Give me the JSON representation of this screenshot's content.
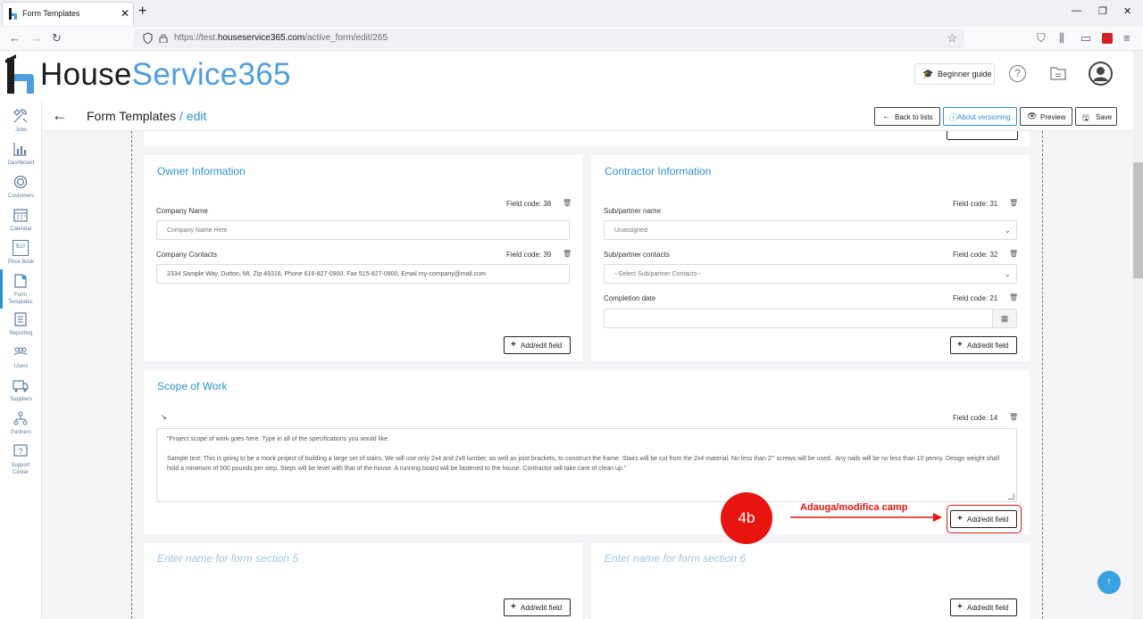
{
  "browser": {
    "tab_title": "Form Templates",
    "url_prefix": "https://test.",
    "url_domain": "houseservice365.com",
    "url_path": "/active_form/edit/265"
  },
  "header": {
    "logo_part1": "House",
    "logo_part2": "Service365",
    "beginner_guide": "Beginner guide"
  },
  "sidebar": {
    "items": [
      {
        "label": "Jobs",
        "icon": "jobs-icon"
      },
      {
        "label": "Dashboard",
        "icon": "dashboard-icon"
      },
      {
        "label": "Customers",
        "icon": "customers-icon"
      },
      {
        "label": "Calendar",
        "icon": "calendar-icon"
      },
      {
        "label": "Price Book",
        "icon": "price-book-icon"
      },
      {
        "label": "Form Templates",
        "icon": "form-templates-icon",
        "active": true
      },
      {
        "label": "Reporting",
        "icon": "reporting-icon"
      },
      {
        "label": "Users",
        "icon": "users-icon"
      },
      {
        "label": "Suppliers",
        "icon": "suppliers-icon"
      },
      {
        "label": "Partners",
        "icon": "partners-icon"
      },
      {
        "label": "Support Center",
        "icon": "support-center-icon"
      }
    ],
    "price_book_tag": "$10"
  },
  "toolbar": {
    "title": "Form Templates",
    "crumb": " / edit",
    "back_to_lists": "Back to lists",
    "about_versioning": "About versioning",
    "preview": "Preview",
    "save": "Save"
  },
  "owner": {
    "title": "Owner Information",
    "field1_code": "Field code: 38",
    "field1_label": "Company Name",
    "field1_placeholder": "Company Name Here",
    "field2_code": "Field code: 39",
    "field2_label": "Company Contacts",
    "field2_value": "2334 Sample Way, Dutton, MI, Zip 49316, Phone 616-827-0900, Fax 515-827-0900, Email my-company@mail.com",
    "add_btn": "Add/edit field"
  },
  "contractor": {
    "title": "Contractor Information",
    "field1_code": "Field code: 31",
    "field1_label": "Sub/partner name",
    "field1_value": "Unassigned",
    "field2_code": "Field code: 32",
    "field2_label": "Sub/partner contacts",
    "field2_value": "--Select Sub/partner Contacts--",
    "field3_code": "Field code: 21",
    "field3_label": "Completion date",
    "add_btn": "Add/edit field"
  },
  "scope": {
    "title": "Scope of Work",
    "field_code": "Field code: 14",
    "line1": "\"Project scope of work goes here. Type in all of the specifications you would like.",
    "line2": "Sample text: This is going to be a mock project of building a large set of stairs. We will use only 2x4 and 2x8 lumber, as well as joist brackets, to construct the frame. Stairs will be cut from the 2x4 material. No less than 2\"' screws will be used.  Any nails will be no less than 10 penny. Design weight shall hold a minimum of 500 pounds per step. Steps will be level with that of the house. A running board will be fastened to the house. Contractor will take care of clean up.\"",
    "add_btn": "Add/edit field"
  },
  "section5": {
    "placeholder": "Enter name for form section 5",
    "add_btn": "Add/edit field"
  },
  "section6": {
    "placeholder": "Enter name for form section 6",
    "add_btn": "Add/edit field"
  },
  "annotation": {
    "step": "4b",
    "label": "Adauga/modifica camp",
    "color": "#e8140f"
  },
  "colors": {
    "accent": "#2c93d1",
    "logo_blue": "#4d9de0"
  }
}
